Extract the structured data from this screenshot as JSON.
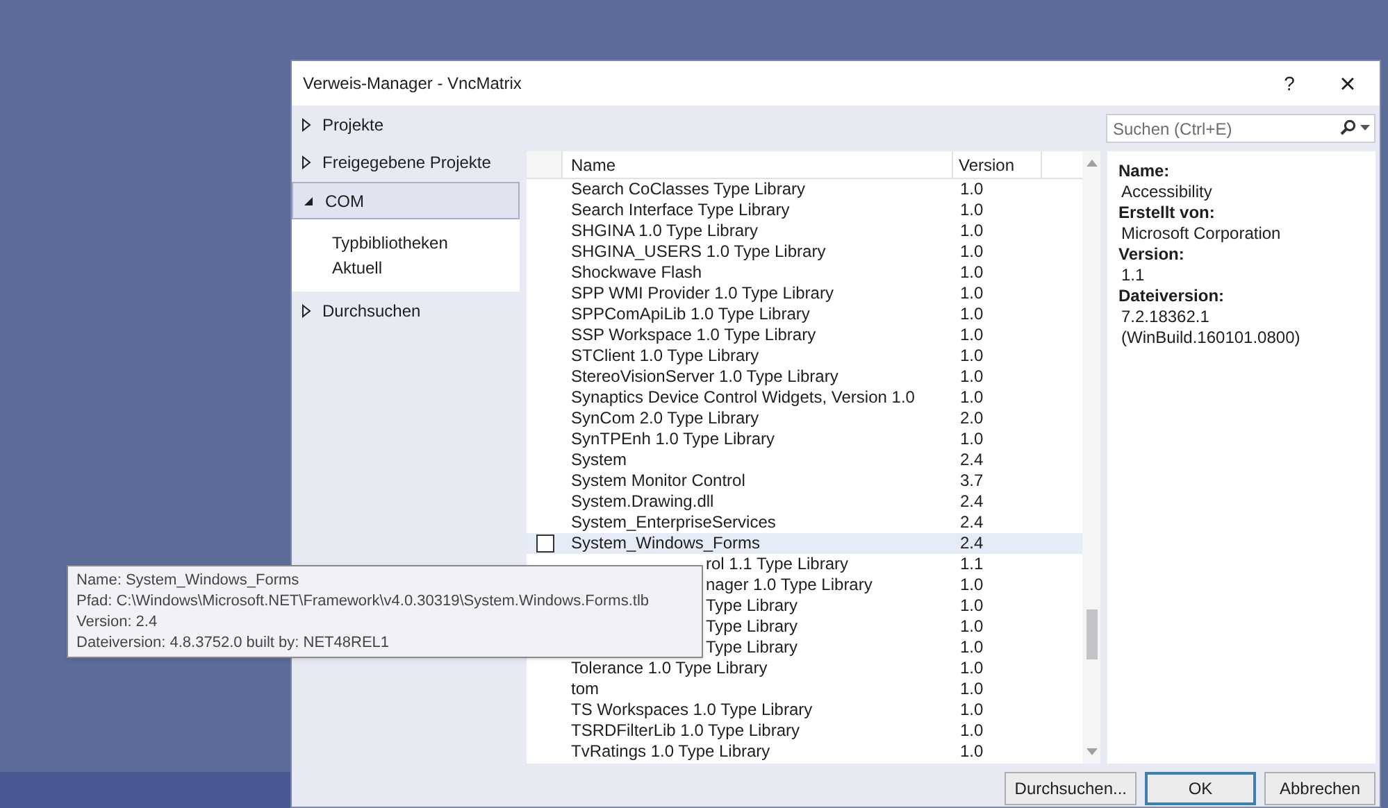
{
  "window": {
    "title": "Verweis-Manager - VncMatrix",
    "help": "?",
    "close": "×"
  },
  "sidebar": {
    "items": [
      {
        "label": "Projekte",
        "expanded": false,
        "selected": false
      },
      {
        "label": "Freigegebene Projekte",
        "expanded": false,
        "selected": false
      },
      {
        "label": "COM",
        "expanded": true,
        "selected": true,
        "children": [
          {
            "label": "Typbibliotheken",
            "selected": false
          },
          {
            "label": "Aktuell",
            "selected": false
          }
        ]
      },
      {
        "label": "Durchsuchen",
        "expanded": false,
        "selected": false
      }
    ]
  },
  "search": {
    "placeholder": "Suchen (Ctrl+E)"
  },
  "table": {
    "columns": [
      "Name",
      "Version"
    ],
    "rows": [
      {
        "kind": "row",
        "name": "Search CoClasses Type Library",
        "version": "1.0",
        "hovered": false
      },
      {
        "kind": "row",
        "name": "Search Interface Type Library",
        "version": "1.0",
        "hovered": false
      },
      {
        "kind": "row",
        "name": "SHGINA 1.0 Type Library",
        "version": "1.0",
        "hovered": false
      },
      {
        "kind": "row",
        "name": "SHGINA_USERS 1.0 Type Library",
        "version": "1.0",
        "hovered": false
      },
      {
        "kind": "row",
        "name": "Shockwave Flash",
        "version": "1.0",
        "hovered": false
      },
      {
        "kind": "row",
        "name": "SPP WMI Provider 1.0 Type Library",
        "version": "1.0",
        "hovered": false
      },
      {
        "kind": "row",
        "name": "SPPComApiLib 1.0 Type Library",
        "version": "1.0",
        "hovered": false
      },
      {
        "kind": "row",
        "name": "SSP Workspace 1.0 Type Library",
        "version": "1.0",
        "hovered": false
      },
      {
        "kind": "row",
        "name": "STClient 1.0 Type Library",
        "version": "1.0",
        "hovered": false
      },
      {
        "kind": "row",
        "name": "StereoVisionServer 1.0 Type Library",
        "version": "1.0",
        "hovered": false
      },
      {
        "kind": "row",
        "name": "Synaptics Device Control Widgets, Version 1.0",
        "version": "1.0",
        "hovered": false
      },
      {
        "kind": "row",
        "name": "SynCom 2.0 Type Library",
        "version": "2.0",
        "hovered": false
      },
      {
        "kind": "row",
        "name": "SynTPEnh 1.0 Type Library",
        "version": "1.0",
        "hovered": false
      },
      {
        "kind": "row",
        "name": "System",
        "version": "2.4",
        "hovered": false
      },
      {
        "kind": "row",
        "name": "System Monitor Control",
        "version": "3.7",
        "hovered": false
      },
      {
        "kind": "row",
        "name": "System.Drawing.dll",
        "version": "2.4",
        "hovered": false
      },
      {
        "kind": "row",
        "name": "System_EnterpriseServices",
        "version": "2.4",
        "hovered": false
      },
      {
        "kind": "row",
        "name": "System_Windows_Forms",
        "version": "2.4",
        "hovered": true,
        "checked": false
      },
      {
        "kind": "covered",
        "name": "rol 1.1 Type Library",
        "version": "1.1",
        "hovered": false
      },
      {
        "kind": "covered",
        "name": "nager 1.0 Type Library",
        "version": "1.0",
        "hovered": false
      },
      {
        "kind": "covered",
        "name": "Type Library",
        "version": "1.0",
        "hovered": false
      },
      {
        "kind": "covered",
        "name": "Type Library",
        "version": "1.0",
        "hovered": false
      },
      {
        "kind": "covered",
        "name": "Type Library",
        "version": "1.0",
        "hovered": false
      },
      {
        "kind": "row",
        "name": "Tolerance 1.0 Type Library",
        "version": "1.0",
        "hovered": false
      },
      {
        "kind": "row",
        "name": "tom",
        "version": "1.0",
        "hovered": false
      },
      {
        "kind": "row",
        "name": "TS Workspaces 1.0 Type Library",
        "version": "1.0",
        "hovered": false
      },
      {
        "kind": "row",
        "name": "TSRDFilterLib 1.0 Type Library",
        "version": "1.0",
        "hovered": false
      },
      {
        "kind": "row",
        "name": "TvRatings 1.0 Type Library",
        "version": "1.0",
        "hovered": false
      }
    ]
  },
  "details": [
    {
      "label": "Name:",
      "values": [
        "Accessibility"
      ]
    },
    {
      "label": "Erstellt von:",
      "values": [
        "Microsoft Corporation"
      ]
    },
    {
      "label": "Version:",
      "values": [
        "1.1"
      ]
    },
    {
      "label": "Dateiversion:",
      "values": [
        "7.2.18362.1",
        "(WinBuild.160101.0800)"
      ]
    }
  ],
  "tooltip": {
    "lines": [
      "Name: System_Windows_Forms",
      "Pfad: C:\\Windows\\Microsoft.NET\\Framework\\v4.0.30319\\System.Windows.Forms.tlb",
      "Version: 2.4",
      "Dateiversion: 4.8.3752.0 built by: NET48REL1"
    ]
  },
  "buttons": [
    {
      "label": "Durchsuchen...",
      "default": false
    },
    {
      "label": "OK",
      "default": true
    },
    {
      "label": "Abbrechen",
      "default": false
    }
  ]
}
